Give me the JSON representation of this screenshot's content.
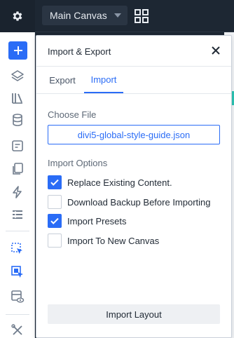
{
  "topbar": {
    "settings_icon": "gear-icon",
    "canvas_select": {
      "value": "Main Canvas"
    },
    "grid_icon": "grid-icon"
  },
  "sidebar": {
    "items": [
      {
        "name": "add",
        "icon": "plus-icon"
      },
      {
        "name": "layers",
        "icon": "layers-icon"
      },
      {
        "name": "library",
        "icon": "library-icon"
      },
      {
        "name": "database",
        "icon": "database-icon"
      },
      {
        "name": "page-settings",
        "icon": "settings-panel-icon"
      },
      {
        "name": "copy",
        "icon": "copy-icon"
      },
      {
        "name": "power",
        "icon": "lightning-icon"
      },
      {
        "name": "list",
        "icon": "list-icon"
      },
      {
        "name": "select",
        "icon": "cursor-select-icon"
      },
      {
        "name": "multi-select",
        "icon": "multi-select-icon"
      },
      {
        "name": "preview",
        "icon": "preview-icon"
      },
      {
        "name": "tools",
        "icon": "tools-icon"
      }
    ]
  },
  "modal": {
    "title": "Import & Export",
    "close_icon": "close-icon",
    "tabs": [
      {
        "label": "Export",
        "active": false
      },
      {
        "label": "Import",
        "active": true
      }
    ],
    "choose_file_label": "Choose File",
    "file_name": "divi5-global-style-guide.json",
    "import_options_label": "Import Options",
    "options": [
      {
        "label": "Replace Existing Content.",
        "checked": true
      },
      {
        "label": "Download Backup Before Importing",
        "checked": false
      },
      {
        "label": "Import Presets",
        "checked": true
      },
      {
        "label": "Import To New Canvas",
        "checked": false
      }
    ],
    "submit_label": "Import Layout"
  },
  "colors": {
    "accent": "#2a6cf6",
    "topbar_bg": "#1d2733",
    "teal_accent": "#2bc4b4"
  }
}
